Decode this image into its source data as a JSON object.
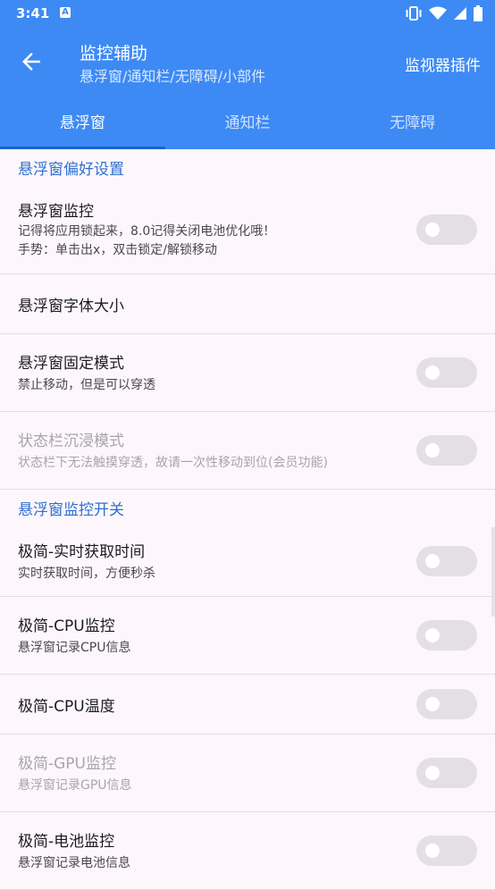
{
  "status_bar": {
    "time": "3:41",
    "notif_icon": "A"
  },
  "header": {
    "title": "监控辅助",
    "subtitle": "悬浮窗/通知栏/无障碍/小部件",
    "action": "监视器插件"
  },
  "tabs": [
    {
      "label": "悬浮窗",
      "active": true
    },
    {
      "label": "通知栏",
      "active": false
    },
    {
      "label": "无障碍",
      "active": false
    }
  ],
  "section1": {
    "title": "悬浮窗偏好设置"
  },
  "item_monitor": {
    "title": "悬浮窗监控",
    "line1": "记得将应用锁起来，8.0记得关闭电池优化哦！",
    "line2": "手势：单击出x，双击锁定/解锁移动"
  },
  "item_fontsize": {
    "title": "悬浮窗字体大小"
  },
  "item_fixed": {
    "title": "悬浮窗固定模式",
    "sub": "禁止移动，但是可以穿透"
  },
  "item_immersive": {
    "title": "状态栏沉浸模式",
    "sub": "状态栏下无法触摸穿透，故请一次性移动到位(会员功能)"
  },
  "section2": {
    "title": "悬浮窗监控开关"
  },
  "item_time": {
    "title": "极简-实时获取时间",
    "sub": "实时获取时间，方便秒杀"
  },
  "item_cpu": {
    "title": "极简-CPU监控",
    "sub": "悬浮窗记录CPU信息"
  },
  "item_cputemp": {
    "title": "极简-CPU温度"
  },
  "item_gpu": {
    "title": "极简-GPU监控",
    "sub": "悬浮窗记录GPU信息"
  },
  "item_battery": {
    "title": "极简-电池监控",
    "sub": "悬浮窗记录电池信息"
  },
  "colors": {
    "primary": "#3d8af5",
    "accent_text": "#2e6fd0",
    "background": "#fdf7fb"
  }
}
